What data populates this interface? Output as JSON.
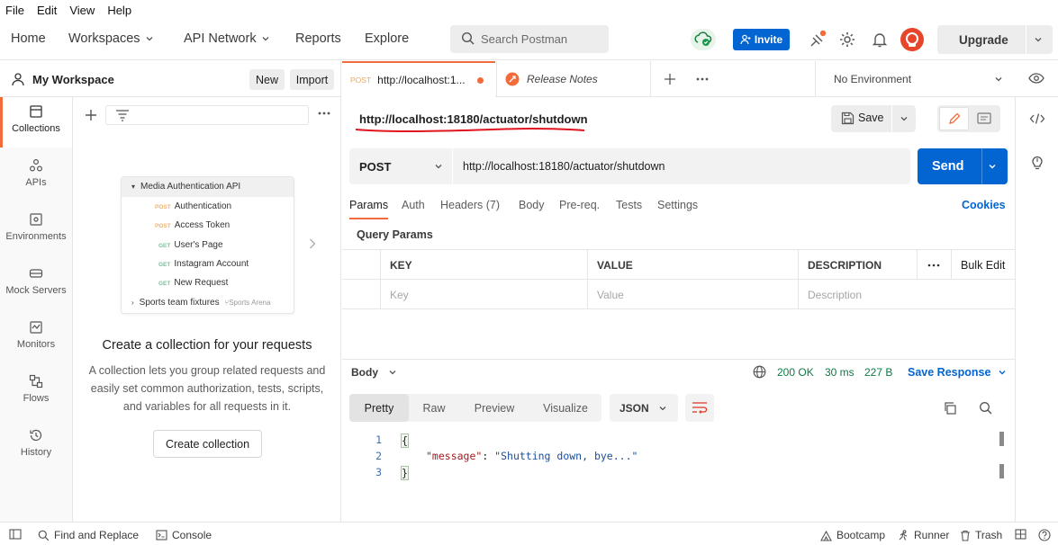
{
  "menubar": {
    "items": [
      "File",
      "Edit",
      "View",
      "Help"
    ]
  },
  "header": {
    "nav": [
      {
        "label": "Home",
        "dropdown": false
      },
      {
        "label": "Workspaces",
        "dropdown": true
      },
      {
        "label": "API Network",
        "dropdown": true
      },
      {
        "label": "Reports",
        "dropdown": false
      },
      {
        "label": "Explore",
        "dropdown": false
      }
    ],
    "search_placeholder": "Search Postman",
    "invite_label": "Invite",
    "upgrade_label": "Upgrade",
    "accent_color": "#F26B3A",
    "primary_color": "#0265D2"
  },
  "workspace": {
    "title": "My Workspace",
    "new_label": "New",
    "import_label": "Import"
  },
  "leftnav": [
    {
      "label": "Collections",
      "icon": "collections-icon",
      "active": true
    },
    {
      "label": "APIs",
      "icon": "apis-icon",
      "active": false
    },
    {
      "label": "Environments",
      "icon": "environments-icon",
      "active": false
    },
    {
      "label": "Mock Servers",
      "icon": "mock-servers-icon",
      "active": false
    },
    {
      "label": "Monitors",
      "icon": "monitors-icon",
      "active": false
    },
    {
      "label": "Flows",
      "icon": "flows-icon",
      "active": false
    },
    {
      "label": "History",
      "icon": "history-icon",
      "active": false
    }
  ],
  "illustration": {
    "folder": "Media Authentication API",
    "requests": [
      {
        "method": "POST",
        "name": "Authentication"
      },
      {
        "method": "POST",
        "name": "Access Token"
      },
      {
        "method": "GET",
        "name": "User's Page"
      },
      {
        "method": "GET",
        "name": "Instagram Account"
      },
      {
        "method": "GET",
        "name": "New Request"
      }
    ],
    "collapsed": "Sports team fixtures",
    "collapsed_tag": "Sports Arena"
  },
  "empty_state": {
    "title": "Create a collection for your requests",
    "description": "A collection lets you group related requests and easily set common authorization, tests, scripts, and variables for all requests in it.",
    "button": "Create collection"
  },
  "tabs": [
    {
      "method": "POST",
      "label": "http://localhost:1...",
      "unsaved": true
    },
    {
      "label": "Release Notes"
    }
  ],
  "environment": "No Environment",
  "request": {
    "title": "http://localhost:18180/actuator/shutdown",
    "save_label": "Save",
    "method": "POST",
    "url": "http://localhost:18180/actuator/shutdown",
    "send_label": "Send",
    "tabs": [
      "Params",
      "Auth",
      "Headers (7)",
      "Body",
      "Pre-req.",
      "Tests",
      "Settings"
    ],
    "active_tab": "Params",
    "cookies_label": "Cookies",
    "query_params_title": "Query Params",
    "columns": [
      "KEY",
      "VALUE",
      "DESCRIPTION"
    ],
    "bulk_edit": "Bulk Edit",
    "placeholders": [
      "Key",
      "Value",
      "Description"
    ]
  },
  "response": {
    "body_label": "Body",
    "status": "200 OK",
    "time": "30 ms",
    "size": "227 B",
    "save_response": "Save Response",
    "view_tabs": [
      "Pretty",
      "Raw",
      "Preview",
      "Visualize"
    ],
    "active_view": "Pretty",
    "format": "JSON",
    "line_numbers": [
      "1",
      "2",
      "3"
    ],
    "open_brace": "{",
    "close_brace": "}",
    "json_key": "\"message\"",
    "json_colon": ": ",
    "json_value": "\"Shutting down, bye...\""
  },
  "footer": {
    "find_replace": "Find and Replace",
    "console": "Console",
    "bootcamp": "Bootcamp",
    "runner": "Runner",
    "trash": "Trash"
  }
}
